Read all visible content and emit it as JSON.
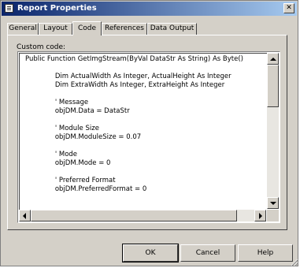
{
  "window": {
    "title": "Report Properties"
  },
  "tabs": [
    {
      "label": "General"
    },
    {
      "label": "Layout"
    },
    {
      "label": "Code"
    },
    {
      "label": "References"
    },
    {
      "label": "Data Output"
    }
  ],
  "active_tab": "Code",
  "custom_code_label": "Custom code:",
  "code_lines": [
    "Public Function GetImgStream(ByVal DataStr As String) As Byte()",
    "",
    "              Dim ActualWidth As Integer, ActualHeight As Integer",
    "              Dim ExtraWidth As Integer, ExtraHeight As Integer",
    "",
    "              ' Message",
    "              objDM.Data = DataStr",
    "",
    "              ' Module Size",
    "              objDM.ModuleSize = 0.07",
    "",
    "              ' Mode",
    "              objDM.Mode = 0",
    "",
    "              ' Preferred Format",
    "              objDM.PreferredFormat = 0",
    ""
  ],
  "buttons": {
    "ok": "OK",
    "cancel": "Cancel",
    "help": "Help"
  },
  "close_glyph": "✕",
  "colors": {
    "title_start": "#0a246a",
    "title_end": "#a6caf0",
    "face": "#d4d0c8"
  },
  "icons": [
    "report-properties-icon",
    "close-icon",
    "scroll-up-arrow-icon",
    "scroll-down-arrow-icon",
    "scroll-left-arrow-icon",
    "scroll-right-arrow-icon",
    "size-grip-icon"
  ]
}
